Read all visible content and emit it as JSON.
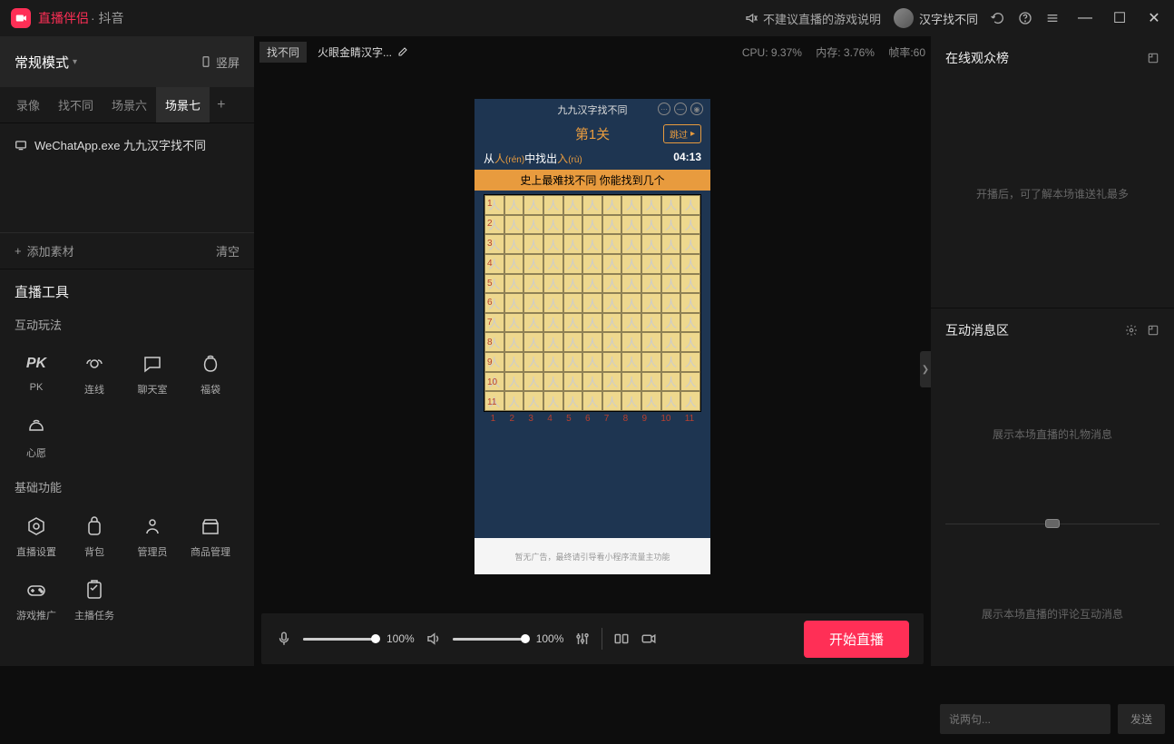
{
  "titlebar": {
    "app_name": "直播伴侣",
    "app_suffix": "· 抖音",
    "notice": "不建议直播的游戏说明",
    "user_name": "汉字找不同"
  },
  "sidebar": {
    "mode_label": "常规模式",
    "orientation": "竖屏",
    "scene_tabs": [
      "录像",
      "找不同",
      "场景六",
      "场景七"
    ],
    "active_tab_index": 3,
    "source_item": "WeChatApp.exe 九九汉字找不同",
    "add_material": "添加素材",
    "clear": "清空",
    "tools_title": "直播工具",
    "interactive_title": "互动玩法",
    "interactive_items": [
      "PK",
      "连线",
      "聊天室",
      "福袋",
      "心愿"
    ],
    "basic_title": "基础功能",
    "basic_items": [
      "直播设置",
      "背包",
      "管理员",
      "商品管理",
      "游戏推广",
      "主播任务"
    ]
  },
  "center": {
    "tab_label": "找不同",
    "scene_title": "火眼金睛汉字...",
    "cpu_label": "CPU: 9.37%",
    "mem_label": "内存: 3.76%",
    "fps_label": "帧率:60",
    "game": {
      "app_title": "九九汉字找不同",
      "level": "第1关",
      "skip": "跳过",
      "rule_prefix": "从",
      "rule_char1": "人",
      "rule_pinyin1": "(rén)",
      "rule_mid": "中找出",
      "rule_char2": "入",
      "rule_pinyin2": "(rù)",
      "timer": "04:13",
      "banner": "史上最难找不同 你能找到几个",
      "char": "人",
      "footer": "暂无广告，最终请引导看小程序流量主功能"
    }
  },
  "bottombar": {
    "mic_volume": "100%",
    "speaker_volume": "100%",
    "start_button": "开始直播"
  },
  "right": {
    "audience_title": "在线观众榜",
    "audience_placeholder": "开播后，可了解本场谁送礼最多",
    "messages_title": "互动消息区",
    "gift_placeholder": "展示本场直播的礼物消息",
    "comment_placeholder_text": "展示本场直播的评论互动消息",
    "input_placeholder": "说两句...",
    "send": "发送"
  }
}
